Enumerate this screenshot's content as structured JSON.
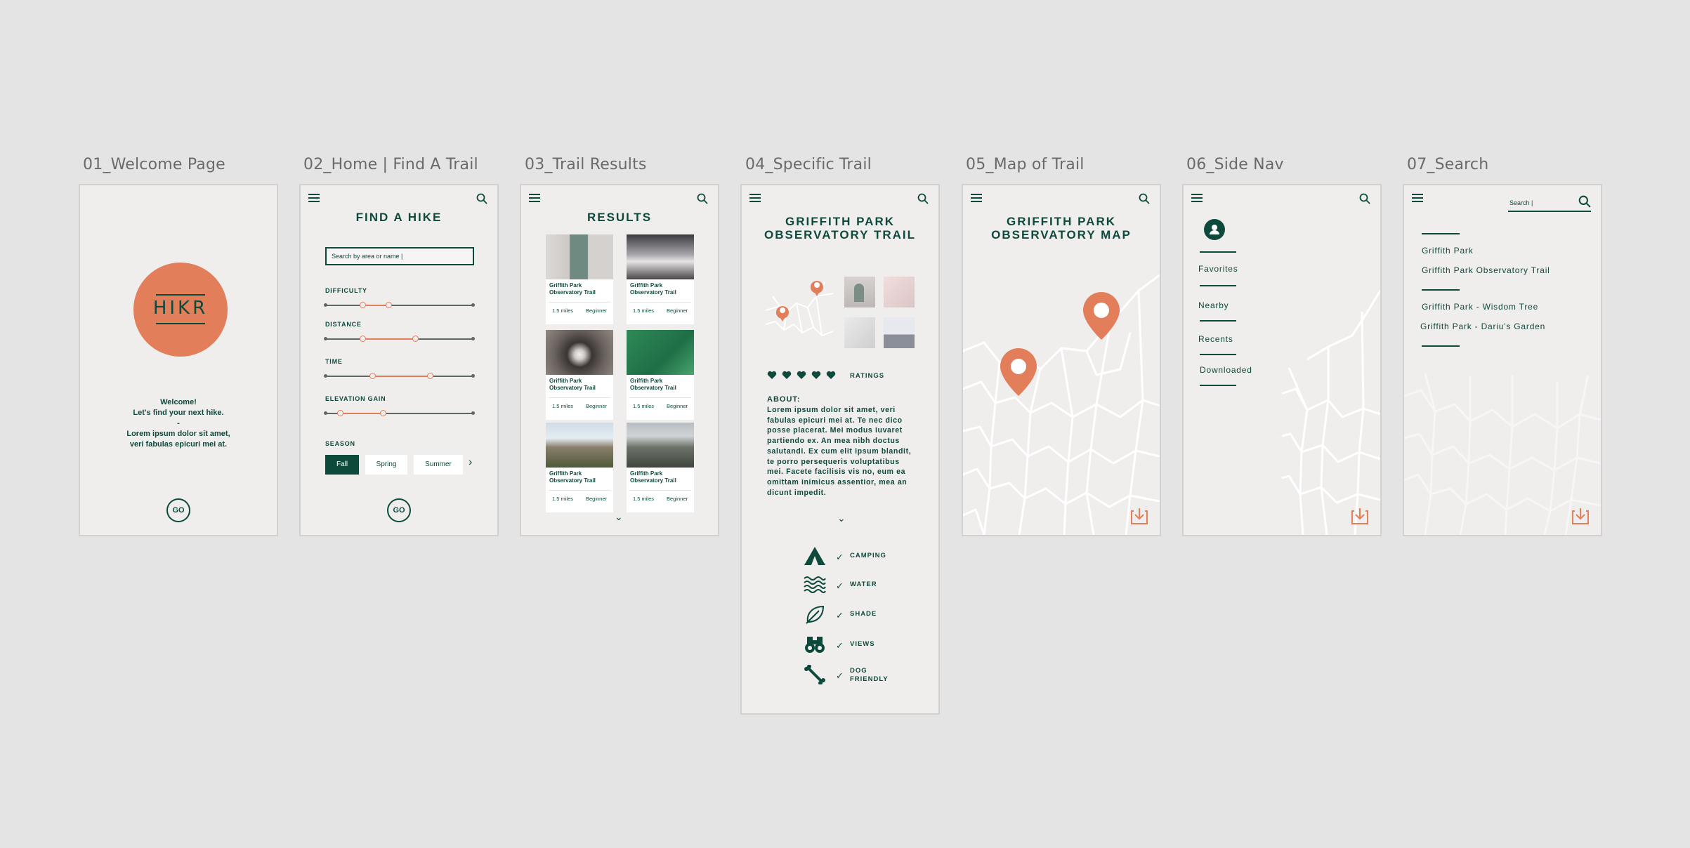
{
  "labels": [
    "01_Welcome Page",
    "02_Home | Find A Trail",
    "03_Trail Results",
    "04_Specific Trail",
    "05_Map of Trail",
    "06_Side Nav",
    "07_Search"
  ],
  "colors": {
    "primary": "#0e4a3c",
    "accent": "#e27f5a",
    "screen_bg": "#f0eded",
    "canvas_bg": "#e5e4e4"
  },
  "welcome": {
    "logo": "HIKR",
    "greeting": "Welcome!",
    "tagline": "Let's find your next hike.",
    "separator": "-",
    "body1": "Lorem ipsum dolor sit amet,",
    "body2": "veri fabulas epicuri mei at.",
    "go": "GO"
  },
  "home": {
    "title": "FIND A HIKE",
    "search_placeholder": "Search by area or name |",
    "sliders": [
      {
        "label": "DIFFICULTY",
        "low": 0.25,
        "high": 0.43
      },
      {
        "label": "DISTANCE",
        "low": 0.25,
        "high": 0.61
      },
      {
        "label": "TIME",
        "low": 0.32,
        "high": 0.71
      },
      {
        "label": "ELEVATION GAIN",
        "low": 0.1,
        "high": 0.39
      }
    ],
    "season_label": "SEASON",
    "seasons": [
      "Fall",
      "Spring",
      "Summer"
    ],
    "selected_season": "Fall",
    "more": "›",
    "go": "GO"
  },
  "results": {
    "title": "RESULTS",
    "cards": [
      {
        "name": "Griffith Park Observatory Trail",
        "distance": "1.5 miles",
        "level": "Beginner",
        "img": "doorway"
      },
      {
        "name": "Griffith Park Observatory Trail",
        "distance": "1.5 miles",
        "level": "Beginner",
        "img": "sunset"
      },
      {
        "name": "Griffith Park Observatory Trail",
        "distance": "1.5 miles",
        "level": "Beginner",
        "img": "tunnel"
      },
      {
        "name": "Griffith Park Observatory Trail",
        "distance": "1.5 miles",
        "level": "Beginner",
        "img": "leaf"
      },
      {
        "name": "Griffith Park Observatory Trail",
        "distance": "1.5 miles",
        "level": "Beginner",
        "img": "mountain"
      },
      {
        "name": "Griffith Park Observatory Trail",
        "distance": "1.5 miles",
        "level": "Beginner",
        "img": "hollywood"
      }
    ],
    "more": "⌄"
  },
  "trail": {
    "title_line1": "GRIFFITH PARK",
    "title_line2": "OBSERVATORY  TRAIL",
    "rating": 5,
    "ratings_label": "RATINGS",
    "about_label": "ABOUT:",
    "about_text": "Lorem ipsum dolor sit amet, veri fabulas epicuri mei at.  Te nec dico posse placerat. Mei modus iuvaret partiendo ex. An mea nibh doctus salutandi. Ex cum elit ipsum blandit, te porro persequeris voluptatibus mei. Facete facilisis vis no, eum ea omittam inimicus assentior, mea an dicunt impedit.",
    "more": "⌄",
    "amenities": [
      {
        "label": "CAMPING",
        "icon": "tent-icon"
      },
      {
        "label": "WATER",
        "icon": "water-icon"
      },
      {
        "label": "SHADE",
        "icon": "leaf-icon"
      },
      {
        "label": "VIEWS",
        "icon": "binoculars-icon"
      },
      {
        "label": "DOG\nFRIENDLY",
        "icon": "bone-icon"
      }
    ]
  },
  "map": {
    "title_line1": "GRIFFITH PARK",
    "title_line2": "OBSERVATORY  MAP"
  },
  "sidenav": {
    "items": [
      "Favorites",
      "Nearby",
      "Recents",
      "Downloaded"
    ]
  },
  "search": {
    "query": "Search |",
    "results": [
      "Griffith Park",
      "Griffith Park Observatory Trail",
      "Griffith Park - Wisdom Tree",
      "Griffith Park - Dariu's Garden"
    ]
  }
}
